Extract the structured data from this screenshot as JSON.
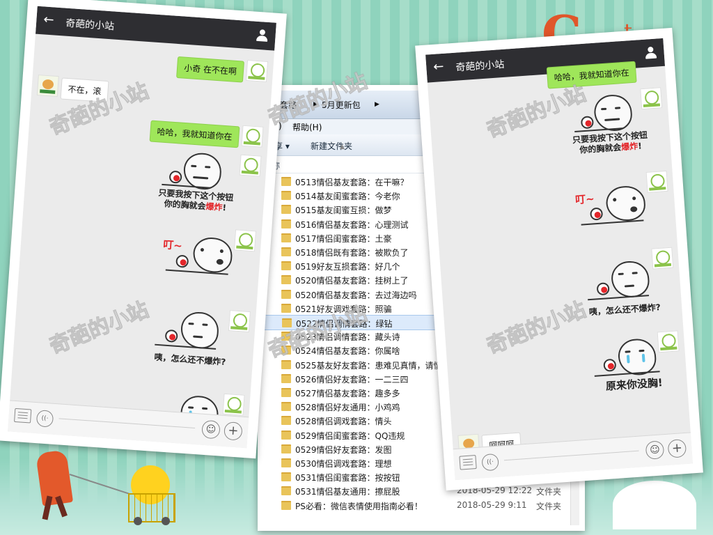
{
  "chat_left": {
    "title": "奇葩的小站",
    "messages": {
      "m1": "小奇 在不在啊",
      "m2": "不在，滚",
      "m3": "哈哈，我就知道你在"
    },
    "meme1": {
      "line1": "只要我按下这个按钮",
      "line2_pre": "你的胸就会",
      "line2_red": "爆炸",
      "line2_post": "!"
    },
    "meme2": {
      "ding": "叮~"
    },
    "meme3": {
      "caption": "咦，怎么还不爆炸?"
    }
  },
  "chat_right": {
    "title": "奇葩的小站",
    "partial_message": "哈哈，我就知道你在",
    "meme1": {
      "line1": "只要我按下这个按钮",
      "line2_pre": "你的胸就会",
      "line2_red": "爆炸",
      "line2_post": "!"
    },
    "meme2": {
      "ding": "叮~"
    },
    "meme3": {
      "caption": "咦，怎么还不爆炸?"
    },
    "meme4": {
      "caption": "原来你没胸!"
    },
    "last_message": "呵呵呵"
  },
  "explorer": {
    "breadcrumb": [
      "套人套路",
      "5月更新包"
    ],
    "menu": {
      "tools": "(T)",
      "help": "帮助(H)"
    },
    "toolbar": {
      "share": "共享 ▾",
      "new_folder": "新建文件夹"
    },
    "column_name": "名称",
    "rows": [
      {
        "name": "0513情侣基友套路：在干嘛？"
      },
      {
        "name": "0514基友闺蜜套路：今老你"
      },
      {
        "name": "0515基友闺蜜互损：做梦"
      },
      {
        "name": "0516情侣基友套路：心理测试"
      },
      {
        "name": "0517情侣闺蜜套路：土豪"
      },
      {
        "name": "0518情侣既有套路：被欺负了"
      },
      {
        "name": "0519好友互损套路：好几个"
      },
      {
        "name": "0520情侣基友套路：挂树上了"
      },
      {
        "name": "0520情侣基友套路：去过海边吗"
      },
      {
        "name": "0521好友调戏套路：照骗"
      },
      {
        "name": "0522情侣调情套路：绿钻",
        "selected": true
      },
      {
        "name": "0523情侣调情套路：藏头诗"
      },
      {
        "name": "0524情侣基友套路：你属啥"
      },
      {
        "name": "0525基友好友套路：患难见真情，请慎..."
      },
      {
        "name": "0526情侣好友套路：一二三四"
      },
      {
        "name": "0527情侣基友套路：趣多多"
      },
      {
        "name": "0528情侣好友通用：小鸡鸡"
      },
      {
        "name": "0528情侣调戏套路：情头"
      },
      {
        "name": "0529情侣闺蜜套路：QQ违规"
      },
      {
        "name": "0529情侣好友套路：发图"
      },
      {
        "name": "0530情侣调戏套路：理想"
      },
      {
        "name": "0531情侣闺蜜套路：按按钮"
      },
      {
        "name": "0531情侣基友通用：擦屁股",
        "date": "2018-05-29 12:22",
        "type": "文件夹"
      },
      {
        "name": "PS必看：微信表情使用指南必看！",
        "date": "2018-05-29 9:11",
        "type": "文件夹"
      }
    ]
  },
  "watermark": "奇葩的小站"
}
